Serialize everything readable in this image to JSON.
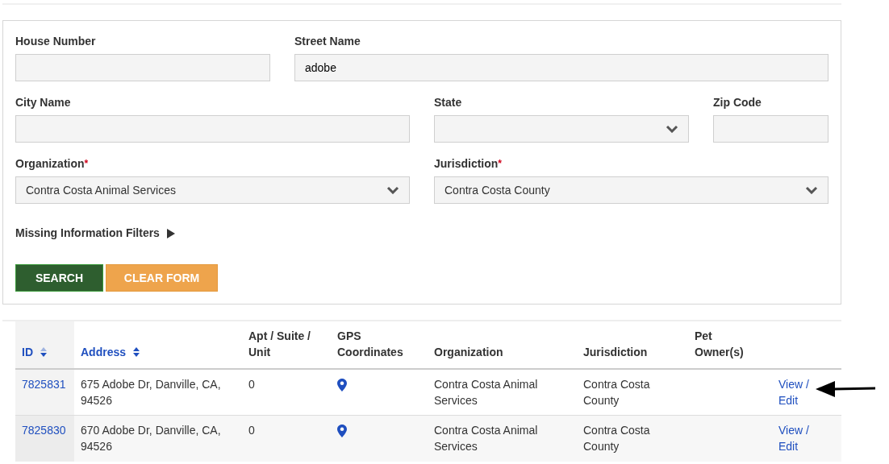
{
  "search_form": {
    "fields": [
      {
        "label": "House Number",
        "kind": "text"
      },
      {
        "label": "Street Name",
        "kind": "text",
        "value": "adobe"
      },
      {
        "label": "City Name",
        "kind": "text"
      },
      {
        "label": "State",
        "kind": "select"
      },
      {
        "label": "Zip Code",
        "kind": "text"
      },
      {
        "label": "Organization",
        "kind": "select",
        "value": "Contra Costa Animal Services",
        "required_mark": "*"
      },
      {
        "label": "Jurisdiction",
        "kind": "select",
        "value": "Contra Costa County",
        "required_mark": "*"
      }
    ],
    "missing_filters": {
      "label": "Missing Information Filters",
      "expanded": false
    },
    "buttons": [
      {
        "label": "SEARCH",
        "kind": "primary"
      },
      {
        "label": "CLEAR FORM",
        "kind": "secondary"
      }
    ]
  },
  "table": {
    "columns": [
      {
        "label": "ID",
        "sortable": true,
        "sorted": true
      },
      {
        "label": "Address",
        "sortable": true,
        "sorted": false
      },
      {
        "label": "Apt / Suite / Unit"
      },
      {
        "label": "GPS Coordinates"
      },
      {
        "label": "Organization"
      },
      {
        "label": "Jurisdiction"
      },
      {
        "label": "Pet Owner(s)"
      }
    ],
    "rows": [
      {
        "id": "7825831",
        "address": "675 Adobe Dr, Danville, CA, 94526",
        "apt": "0",
        "gps": true,
        "organization": "Contra Costa Animal Services",
        "jurisdiction": "Contra Costa County",
        "action": "View / Edit",
        "pointed": true
      },
      {
        "id": "7825830",
        "address": "670 Adobe Dr, Danville, CA, 94526",
        "apt": "0",
        "gps": true,
        "organization": "Contra Costa Animal Services",
        "jurisdiction": "Contra Costa County",
        "action": "View / Edit",
        "pointed": false
      }
    ]
  }
}
